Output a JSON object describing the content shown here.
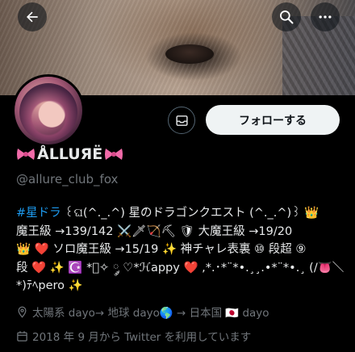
{
  "header": {
    "back_icon": "arrow-left-icon",
    "search_icon": "search-icon",
    "more_icon": "more-dots-icon"
  },
  "profile": {
    "display_name": "ÅLLURËË",
    "display_name_text": "ÅLLUЯË",
    "handle": "@allure_club_fox",
    "follow_label": "フォローする",
    "message_icon": "envelope-icon"
  },
  "bio": {
    "line1_hashtag": "#星ドラ",
    "line1_rest": " ꒰ଘ(^._.^) 星のドラゴンクエスト (^._.^)꒱ 👑",
    "line2": "魔王級 →139/142 ⚔️🗡🏹⛏ 🛡 大魔王級 →19/20",
    "line3": "👑 ❤️ ソロ魔王級 →15/19 ✨ 神チャレ表裏 ⑩ 段超 ⑨",
    "line4": "段 ❤️ ✨ ☪️ *゚✧ ༘ ♡*ℋappy ❤️ ,*.･*¨*•.¸¸.•*¨*•.¸ (/👅＼",
    "line5": "*)ﾃﾍpero ✨"
  },
  "meta": {
    "location": "太陽系 dayo→ 地球 dayo🌎 → 日本国 🇯🇵 dayo",
    "joined": "2018 年 9 月から Twitter を利用しています",
    "location_icon": "location-pin-icon",
    "calendar_icon": "calendar-icon"
  },
  "colors": {
    "background": "#000000",
    "text": "#e7e9ea",
    "muted": "#71767b",
    "link": "#1d9bf0",
    "follow_button_bg": "#eff3f4"
  }
}
